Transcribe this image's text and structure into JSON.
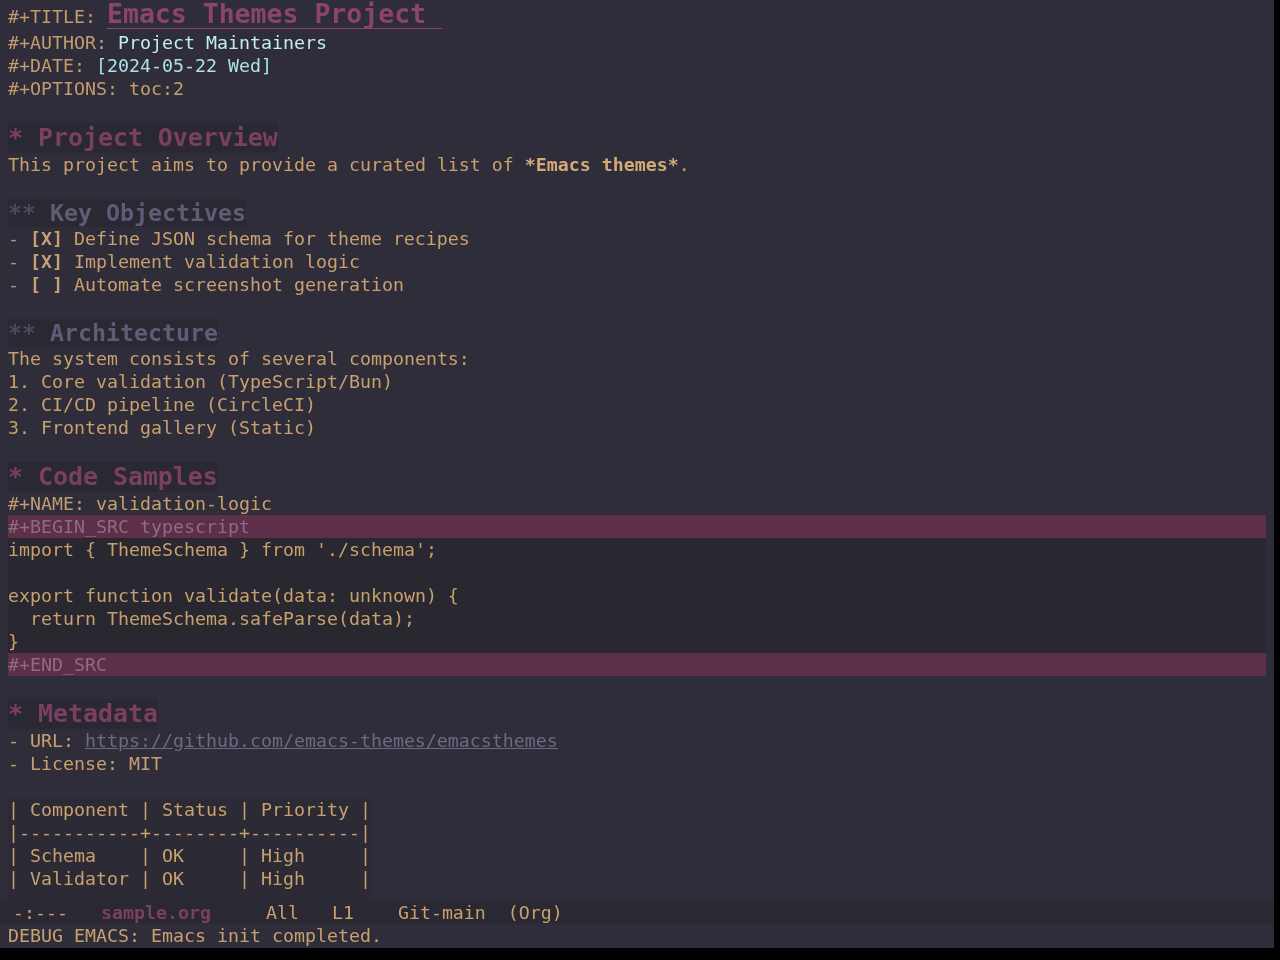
{
  "header": [
    {
      "kind": "title",
      "key": "#+TITLE:",
      "value": "Emacs Themes Project"
    },
    {
      "kind": "author",
      "key": "#+AUTHOR:",
      "value": "Project Maintainers"
    },
    {
      "kind": "date",
      "key": "#+DATE:",
      "value": "[2024-05-22 Wed]"
    },
    {
      "kind": "option",
      "key": "#+OPTIONS:",
      "value": "toc:2"
    }
  ],
  "sections": [
    {
      "marker": "*",
      "title": "Project Overview",
      "body": [
        {
          "kind": "paragraph",
          "runs": [
            {
              "text": "This project aims to provide a curated list of ",
              "bold": false
            },
            {
              "text": "*Emacs themes*",
              "bold": true
            },
            {
              "text": ".",
              "bold": false
            }
          ]
        }
      ],
      "children": [
        {
          "marker": "**",
          "title": "Key Objectives",
          "body": [
            {
              "kind": "checklist",
              "items": [
                {
                  "bullet": "-",
                  "checkbox": "[X]",
                  "text": "Define JSON schema for theme recipes"
                },
                {
                  "bullet": "-",
                  "checkbox": "[X]",
                  "text": "Implement validation logic"
                },
                {
                  "bullet": "-",
                  "checkbox": "[ ]",
                  "text": "Automate screenshot generation"
                }
              ]
            }
          ]
        },
        {
          "marker": "**",
          "title": "Architecture",
          "body": [
            {
              "kind": "paragraph",
              "runs": [
                {
                  "text": "The system consists of several components:",
                  "bold": false
                }
              ]
            },
            {
              "kind": "numbered",
              "items": [
                "1. Core validation (TypeScript/Bun)",
                "2. CI/CD pipeline (CircleCI)",
                "3. Frontend gallery (Static)"
              ]
            }
          ]
        }
      ]
    },
    {
      "marker": "*",
      "title": "Code Samples",
      "body": [
        {
          "kind": "keyword",
          "key": "#+NAME:",
          "value": "validation-logic"
        },
        {
          "kind": "src_block",
          "begin": "#+BEGIN_SRC typescript",
          "code": "import { ThemeSchema } from './schema';\n\nexport function validate(data: unknown) {\n  return ThemeSchema.safeParse(data);\n}",
          "end": "#+END_SRC"
        }
      ]
    },
    {
      "marker": "*",
      "title": "Metadata",
      "body": [
        {
          "kind": "list",
          "items": [
            {
              "bullet": "-",
              "label": "URL:",
              "link": "https://github.com/emacs-themes/emacsthemes"
            },
            {
              "bullet": "-",
              "label": "License:",
              "value": "MIT"
            }
          ]
        },
        {
          "kind": "table",
          "header": "| Component | Status | Priority |",
          "rule": "|-----------+--------+----------|",
          "rows": [
            "| Schema    | OK     | High     |",
            "| Validator | OK     | High     |"
          ]
        }
      ]
    }
  ],
  "mode_line": {
    "status": "-:---",
    "buffer": "sample.org",
    "position": "All",
    "line": "L1",
    "vc": "Git-main",
    "mode": "(Org)"
  },
  "echo_area": {
    "message": "DEBUG EMACS: Emacs init completed."
  }
}
